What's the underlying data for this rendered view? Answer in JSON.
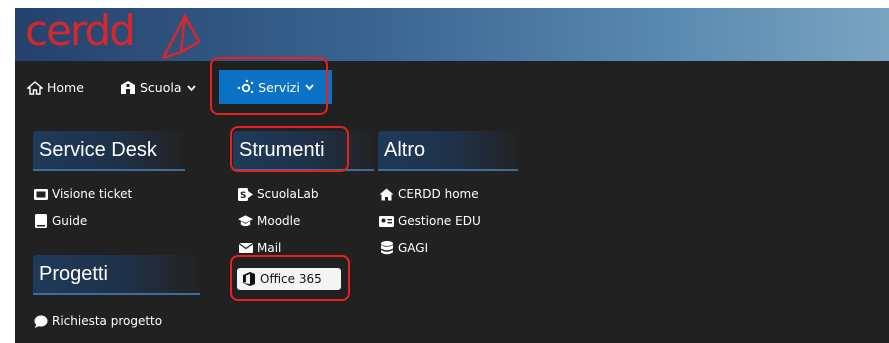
{
  "brand": {
    "logo_text": "cerdd"
  },
  "nav": {
    "home": {
      "label": "Home",
      "icon": "home-icon"
    },
    "scuola": {
      "label": "Scuola",
      "icon": "school-icon"
    },
    "servizi": {
      "label": "Servizi",
      "icon": "network-icon"
    }
  },
  "menu": {
    "service_desk": {
      "title": "Service Desk",
      "items": [
        {
          "label": "Visione ticket",
          "icon": "ticket-icon"
        },
        {
          "label": "Guide",
          "icon": "book-icon"
        }
      ]
    },
    "progetti": {
      "title": "Progetti",
      "items": [
        {
          "label": "Richiesta progetto",
          "icon": "chat-icon"
        }
      ]
    },
    "strumenti": {
      "title": "Strumenti",
      "items": [
        {
          "label": "ScuolaLab",
          "icon": "scuolalab-icon"
        },
        {
          "label": "Moodle",
          "icon": "graduation-cap-icon"
        },
        {
          "label": "Mail",
          "icon": "envelope-icon"
        },
        {
          "label": "Office 365",
          "icon": "office-icon"
        }
      ]
    },
    "altro": {
      "title": "Altro",
      "items": [
        {
          "label": "CERDD home",
          "icon": "home-icon"
        },
        {
          "label": "Gestione EDU",
          "icon": "id-card-icon"
        },
        {
          "label": "GAGI",
          "icon": "database-icon"
        }
      ]
    }
  },
  "colors": {
    "accent": "#0b72c5",
    "highlight": "#e8201f",
    "logo": "#d8262d",
    "menu_bg": "#212121"
  }
}
